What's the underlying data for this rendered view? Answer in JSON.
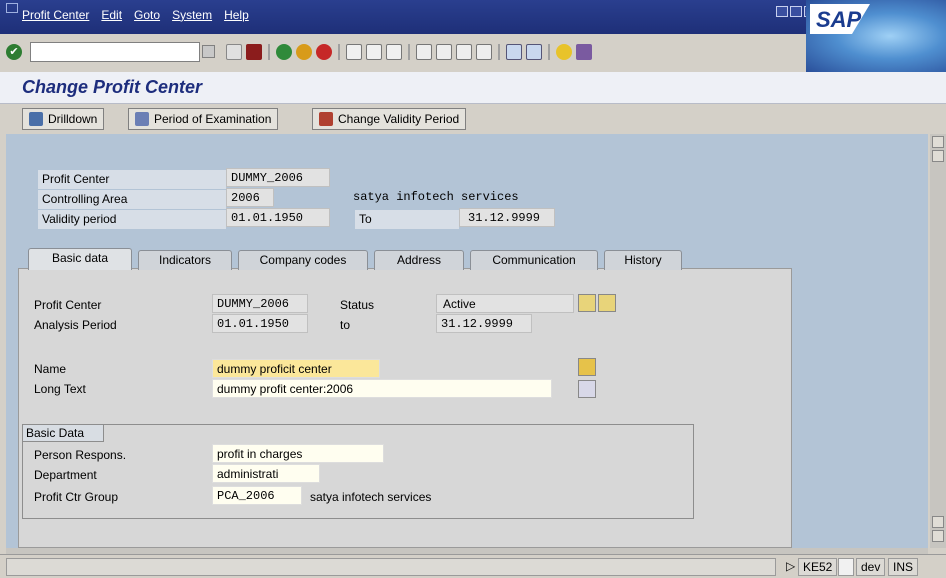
{
  "menu": [
    "Profit Center",
    "Edit",
    "Goto",
    "System",
    "Help"
  ],
  "brand": "SAP",
  "app_title": "Change Profit Center",
  "app_toolbar": {
    "drilldown": "Drilldown",
    "period_exam": "Period of Examination",
    "change_validity": "Change Validity Period"
  },
  "header": {
    "profit_center_label": "Profit Center",
    "profit_center_value": "DUMMY_2006",
    "controlling_area_label": "Controlling Area",
    "controlling_area_value": "2006",
    "controlling_area_text": "satya infotech  services",
    "validity_label": "Validity period",
    "validity_from": "01.01.1950",
    "to_label": "To",
    "validity_to": "31.12.9999"
  },
  "tabs": [
    "Basic data",
    "Indicators",
    "Company codes",
    "Address",
    "Communication",
    "History"
  ],
  "basic": {
    "profit_center_label": "Profit Center",
    "profit_center_value": "DUMMY_2006",
    "status_label": "Status",
    "status_value": "Active",
    "analysis_label": "Analysis Period",
    "analysis_from": "01.01.1950",
    "to_label": "to",
    "analysis_to": "31.12.9999",
    "name_label": "Name",
    "name_value": "dummy proficit center",
    "long_text_label": "Long Text",
    "long_text_value": "dummy profit center:2006",
    "group_title": "Basic Data",
    "person_label": "Person Respons.",
    "person_value": "profit in charges",
    "department_label": "Department",
    "department_value": "administrati",
    "group_label": "Profit Ctr Group",
    "group_value": "PCA_2006",
    "group_text": "satya infotech  services"
  },
  "status_bar": {
    "tcode": "KE52",
    "user": "dev",
    "mode": "INS"
  },
  "colors": {
    "title_bar": "#1e2f78",
    "app_title_text": "#1d2d7d",
    "main_bg": "#b3c4d6",
    "highlight_field": "#fbe79a"
  }
}
